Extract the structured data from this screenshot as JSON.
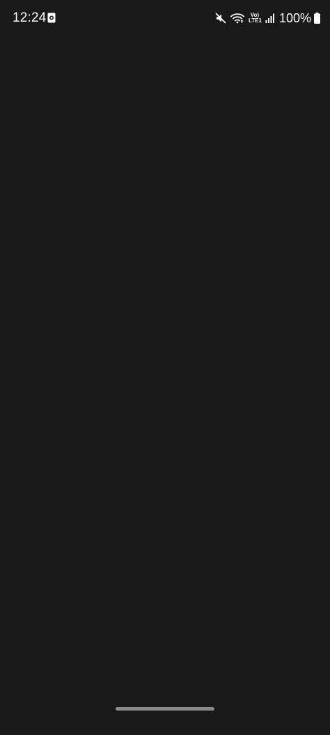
{
  "status_bar": {
    "time": "12:24",
    "notification_icon": "app-notification-icon",
    "mute_icon": "mute-icon",
    "wifi_icon": "wifi-icon",
    "volte_line1": "Vo)",
    "volte_line2": "LTE1",
    "signal_icon": "cell-signal-icon",
    "battery_percent": "100%",
    "battery_icon": "battery-icon"
  },
  "colors": {
    "background": "#191919",
    "text": "#ffffff",
    "home_indicator": "#8a8a8a"
  }
}
